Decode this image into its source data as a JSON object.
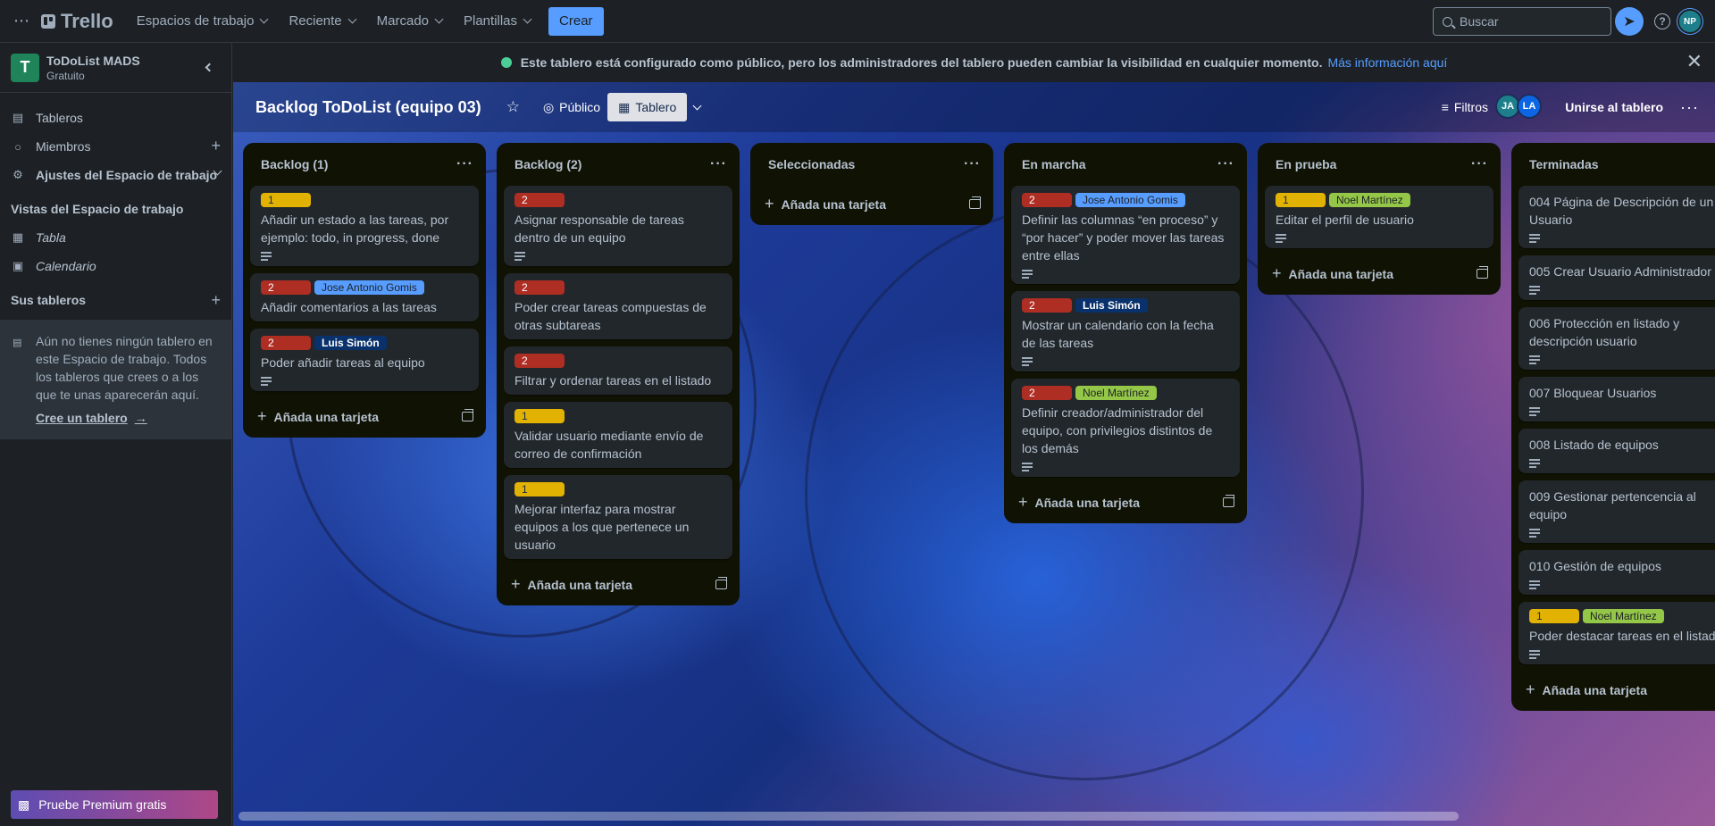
{
  "topbar": {
    "brand": "Trello",
    "nav": [
      "Espacios de trabajo",
      "Reciente",
      "Marcado",
      "Plantillas"
    ],
    "create": "Crear",
    "search_placeholder": "Buscar",
    "user_initials": "NP"
  },
  "sidebar": {
    "workspace_initial": "T",
    "workspace_name": "ToDoList MADS",
    "workspace_plan": "Gratuito",
    "items": [
      {
        "label": "Tableros"
      },
      {
        "label": "Miembros"
      },
      {
        "label": "Ajustes del Espacio de trabajo"
      }
    ],
    "views_title": "Vistas del Espacio de trabajo",
    "views": [
      {
        "label": "Tabla"
      },
      {
        "label": "Calendario"
      }
    ],
    "boards_title": "Sus tableros",
    "empty_text": "Aún no tienes ningún tablero en este Espacio de trabajo. Todos los tableros que crees o a los que te unas aparecerán aquí.",
    "create_link": "Cree un tablero",
    "premium": "Pruebe Premium gratis"
  },
  "banner": {
    "text": "Este tablero está configurado como público, pero los administradores del tablero pueden cambiar la visibilidad en cualquier momento.",
    "link": "Más información aquí"
  },
  "board": {
    "title": "Backlog ToDoList (equipo 03)",
    "visibility": "Público",
    "view": "Tablero",
    "filters": "Filtros",
    "members": [
      "JA",
      "LA"
    ],
    "join": "Unirse al tablero"
  },
  "add_card": "Añada una tarjeta",
  "lists": [
    {
      "title": "Backlog (1)",
      "cards": [
        {
          "labels": [
            {
              "text": "1",
              "color": "yellow"
            }
          ],
          "title": "Añadir un estado a las tareas, por ejemplo: todo, in progress, done",
          "desc": true
        },
        {
          "labels": [
            {
              "text": "2",
              "color": "red"
            },
            {
              "text": "Jose Antonio Gomis",
              "color": "blue"
            }
          ],
          "title": "Añadir comentarios a las tareas",
          "desc": false
        },
        {
          "labels": [
            {
              "text": "2",
              "color": "red"
            },
            {
              "text": "Luis Simón",
              "color": "navy"
            }
          ],
          "title": "Poder añadir tareas al equipo",
          "desc": true
        }
      ]
    },
    {
      "title": "Backlog (2)",
      "cards": [
        {
          "labels": [
            {
              "text": "2",
              "color": "red"
            }
          ],
          "title": "Asignar responsable de tareas dentro de un equipo",
          "desc": true
        },
        {
          "labels": [
            {
              "text": "2",
              "color": "red"
            }
          ],
          "title": "Poder crear tareas compuestas de otras subtareas",
          "desc": false
        },
        {
          "labels": [
            {
              "text": "2",
              "color": "red"
            }
          ],
          "title": "Filtrar y ordenar tareas en el listado",
          "desc": false
        },
        {
          "labels": [
            {
              "text": "1",
              "color": "yellow"
            }
          ],
          "title": "Validar usuario mediante envío de correo de confirmación",
          "desc": false
        },
        {
          "labels": [
            {
              "text": "1",
              "color": "yellow"
            }
          ],
          "title": "Mejorar interfaz para mostrar equipos a los que pertenece un usuario",
          "desc": false
        }
      ]
    },
    {
      "title": "Seleccionadas",
      "cards": []
    },
    {
      "title": "En marcha",
      "cards": [
        {
          "labels": [
            {
              "text": "2",
              "color": "red"
            },
            {
              "text": "Jose Antonio Gomis",
              "color": "blue"
            }
          ],
          "title": "Definir las columnas “en proceso” y “por hacer” y poder mover las tareas entre ellas",
          "desc": true
        },
        {
          "labels": [
            {
              "text": "2",
              "color": "red"
            },
            {
              "text": "Luis Simón",
              "color": "navy"
            }
          ],
          "title": "Mostrar un calendario con la fecha de las tareas",
          "desc": true
        },
        {
          "labels": [
            {
              "text": "2",
              "color": "red"
            },
            {
              "text": "Noel Martínez",
              "color": "green"
            }
          ],
          "title": "Definir creador/administrador del equipo, con privilegios distintos de los demás",
          "desc": true
        }
      ]
    },
    {
      "title": "En prueba",
      "cards": [
        {
          "labels": [
            {
              "text": "1",
              "color": "yellow"
            },
            {
              "text": "Noel Martínez",
              "color": "green"
            }
          ],
          "title": "Editar el perfil de usuario",
          "desc": true
        }
      ]
    },
    {
      "title": "Terminadas",
      "cards": [
        {
          "labels": [],
          "title": "004 Página de Descripción de un Usuario",
          "desc": true
        },
        {
          "labels": [],
          "title": "005 Crear Usuario Administrador",
          "desc": true
        },
        {
          "labels": [],
          "title": "006 Protección en listado y descripción usuario",
          "desc": true
        },
        {
          "labels": [],
          "title": "007 Bloquear Usuarios",
          "desc": true
        },
        {
          "labels": [],
          "title": "008 Listado de equipos",
          "desc": true
        },
        {
          "labels": [],
          "title": "009 Gestionar pertencencia al equipo",
          "desc": true
        },
        {
          "labels": [],
          "title": "010 Gestión de equipos",
          "desc": true
        },
        {
          "labels": [
            {
              "text": "1",
              "color": "yellow"
            },
            {
              "text": "Noel Martínez",
              "color": "green"
            }
          ],
          "title": "Poder destacar tareas en el listado",
          "desc": true
        }
      ]
    }
  ]
}
